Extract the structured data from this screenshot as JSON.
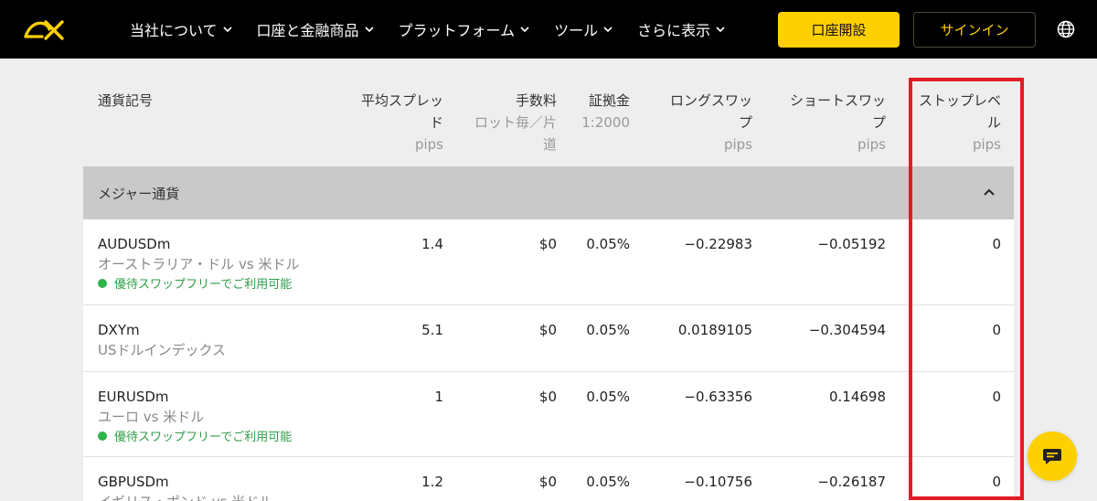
{
  "nav": {
    "menu": [
      {
        "label": "当社について"
      },
      {
        "label": "口座と金融商品"
      },
      {
        "label": "プラットフォーム"
      },
      {
        "label": "ツール"
      },
      {
        "label": "さらに表示"
      }
    ],
    "open_account": "口座開設",
    "sign_in": "サインイン",
    "colors": {
      "background": "#000000",
      "accent": "#ffd000"
    }
  },
  "table": {
    "headers": {
      "symbol": "通貨記号",
      "spread_l1": "平均スプレッ",
      "spread_l2": "ド",
      "spread_unit": "pips",
      "commission": "手数料",
      "commission_sub_l1": "ロット毎／片",
      "commission_sub_l2": "道",
      "margin": "証拠金",
      "margin_sub": "1:2000",
      "long_l1": "ロングスワッ",
      "long_l2": "プ",
      "long_unit": "pips",
      "short_l1": "ショートスワッ",
      "short_l2": "プ",
      "short_unit": "pips",
      "stop_l1": "ストップレベ",
      "stop_l2": "ル",
      "stop_unit": "pips"
    },
    "group": "メジャー通貨",
    "rows": [
      {
        "symbol": "AUDUSDm",
        "desc": "オーストラリア・ドル vs 米ドル",
        "promo": "優待スワップフリーでご利用可能",
        "spread": "1.4",
        "commission": "$0",
        "margin": "0.05%",
        "long": "−0.22983",
        "short": "−0.05192",
        "stop": "0"
      },
      {
        "symbol": "DXYm",
        "desc": "USドルインデックス",
        "promo": "",
        "spread": "5.1",
        "commission": "$0",
        "margin": "0.05%",
        "long": "0.0189105",
        "short": "−0.304594",
        "stop": "0"
      },
      {
        "symbol": "EURUSDm",
        "desc": "ユーロ vs 米ドル",
        "promo": "優待スワップフリーでご利用可能",
        "spread": "1",
        "commission": "$0",
        "margin": "0.05%",
        "long": "−0.63356",
        "short": "0.14698",
        "stop": "0"
      },
      {
        "symbol": "GBPUSDm",
        "desc": "イギリス・ポンド vs 米ドル",
        "promo": "",
        "spread": "1.2",
        "commission": "$0",
        "margin": "0.05%",
        "long": "−0.10756",
        "short": "−0.26187",
        "stop": "0"
      }
    ],
    "highlight_color": "#e31b23"
  }
}
